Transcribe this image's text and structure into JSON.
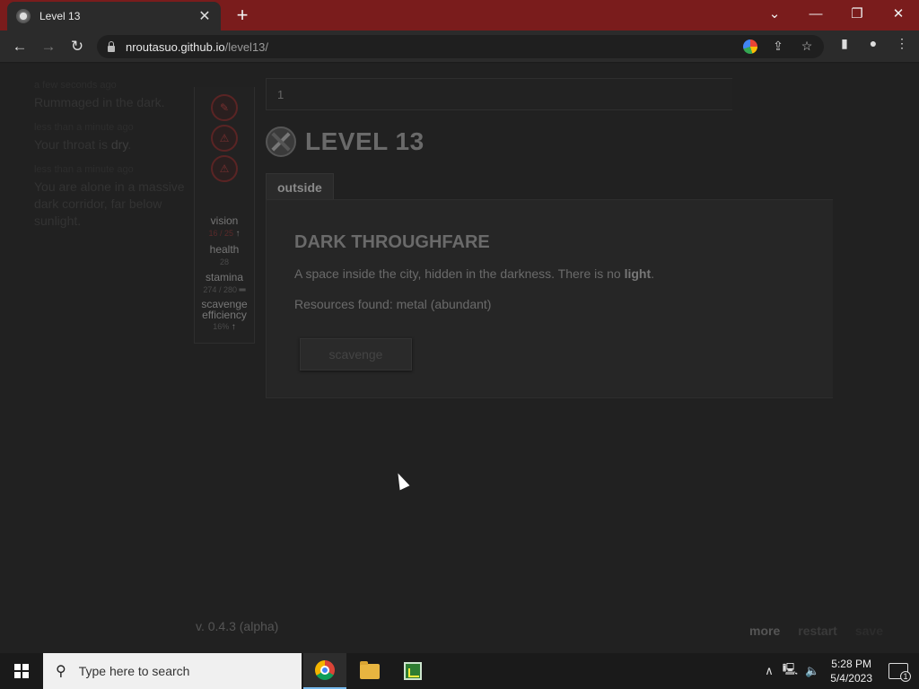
{
  "browser": {
    "tab_title": "Level 13",
    "url_host": "nroutasuo.github.io",
    "url_path": "/level13/"
  },
  "log": [
    {
      "time": "a few seconds ago",
      "text": "Rummaged in the dark."
    },
    {
      "time": "less than a minute ago",
      "text_before": "Your throat is ",
      "text_bold": "dry",
      "text_after": "."
    },
    {
      "time": "less than a minute ago",
      "text": "You are alone in a massive dark corridor, far below sunlight."
    }
  ],
  "stats": {
    "vision": {
      "label": "vision",
      "value": "16 / 25"
    },
    "health": {
      "label": "health",
      "value": "28"
    },
    "stamina": {
      "label": "stamina",
      "value": "274 / 280"
    },
    "scavenge": {
      "label": "scavenge efficiency",
      "value": "16%"
    }
  },
  "header": {
    "position": "1"
  },
  "game": {
    "title": "LEVEL 13",
    "tab": "outside",
    "location_name": "DARK THROUGHFARE",
    "desc_before": "A space inside the city, hidden in the darkness. There is no ",
    "desc_bold": "light",
    "desc_after": ".",
    "resources": "Resources found: metal (abundant)",
    "scavenge_label": "scavenge"
  },
  "footer": {
    "version": "v. 0.4.3 (alpha)",
    "more": "more",
    "restart": "restart",
    "save": "save"
  },
  "taskbar": {
    "search_placeholder": "Type here to search",
    "time": "5:28 PM",
    "date": "5/4/2023",
    "notifications": "1"
  },
  "colors": {
    "titlebar": "#7a1c1c",
    "page_bg": "#212121",
    "perk_border": "#5a2424"
  }
}
